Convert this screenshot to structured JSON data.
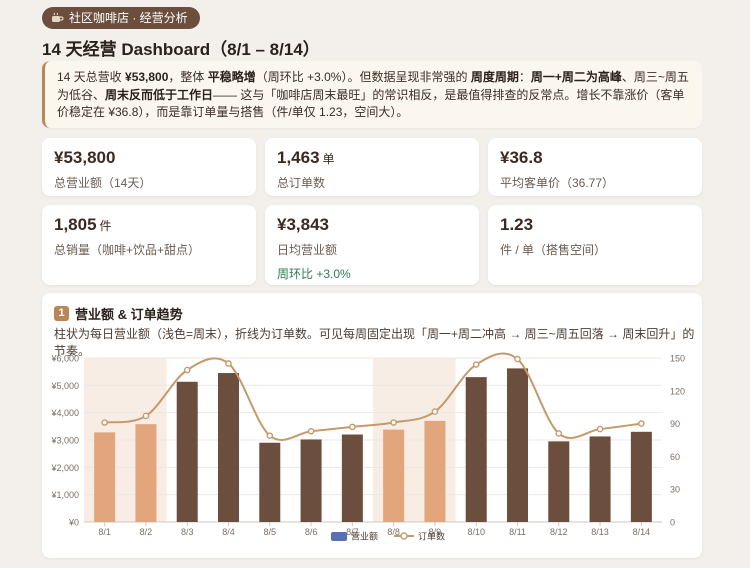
{
  "header": {
    "tag": "社区咖啡店 · 经营分析",
    "title": "14 天经营 Dashboard（8/1 – 8/14）"
  },
  "summary": {
    "s1": "14 天总营收 ",
    "s2": "¥53,800",
    "s3": "，整体 ",
    "s4": "平稳略增",
    "s5": "（周环比 +3.0%）。但数据呈现非常强的 ",
    "s6": "周度周期",
    "s7": "：",
    "s8": "周一+周二为高峰",
    "s9": "、周三~周五为低谷、",
    "s10": "周末反而低于工作日",
    "s11": "—— 这与「咖啡店周末最旺」的常识相反，是最值得排查的反常点。增长不靠涨价（客单价稳定在 ¥36.8），而是靠订单量与搭售（件/单仅 1.23，空间大）。"
  },
  "kpis": [
    {
      "value": "¥53,800",
      "unit": "",
      "label": "总营业额（14天）",
      "delta": ""
    },
    {
      "value": "1,463",
      "unit": "单",
      "label": "总订单数",
      "delta": ""
    },
    {
      "value": "¥36.8",
      "unit": "",
      "label": "平均客单价（36.77）",
      "delta": ""
    },
    {
      "value": "1,805",
      "unit": "件",
      "label": "总销量（咖啡+饮品+甜点）",
      "delta": ""
    },
    {
      "value": "¥3,843",
      "unit": "",
      "label": "日均营业额",
      "delta": "周环比 +3.0%"
    },
    {
      "value": "1.23",
      "unit": "",
      "label": "件 / 单（搭售空间）",
      "delta": ""
    }
  ],
  "chart_section": {
    "badge": "1",
    "title": "营业额 & 订单趋势",
    "desc": "柱状为每日营业额（浅色=周末），折线为订单数。可见每周固定出现「周一+周二冲高 → 周三~周五回落 → 周末回升」的节奏。"
  },
  "colors": {
    "weekday_bar": "#6b4e3d",
    "weekend_bar": "#e3a57c",
    "weekend_band": "#f8ede4",
    "line": "#c49a6c",
    "accent": "#b98757"
  },
  "chart_data": {
    "type": "bar",
    "categories": [
      "8/1",
      "8/2",
      "8/3",
      "8/4",
      "8/5",
      "8/6",
      "8/7",
      "8/8",
      "8/9",
      "8/10",
      "8/11",
      "8/12",
      "8/13",
      "8/14"
    ],
    "weekend": [
      true,
      true,
      false,
      false,
      false,
      false,
      false,
      true,
      true,
      false,
      false,
      false,
      false,
      false
    ],
    "series": [
      {
        "name": "营业额",
        "type": "bar",
        "axis": "left",
        "values": [
          3280,
          3580,
          5130,
          5450,
          2900,
          3020,
          3200,
          3380,
          3700,
          5300,
          5620,
          2950,
          3130,
          3300
        ]
      },
      {
        "name": "订单数",
        "type": "line",
        "axis": "right",
        "values": [
          91,
          97,
          139,
          145,
          79,
          83,
          87,
          91,
          101,
          144,
          149,
          81,
          85,
          90
        ]
      }
    ],
    "y_left": {
      "min": 0,
      "max": 6000,
      "ticks": [
        "¥0",
        "¥1,000",
        "¥2,000",
        "¥3,000",
        "¥4,000",
        "¥5,000",
        "¥6,000"
      ]
    },
    "y_right": {
      "min": 0,
      "max": 150,
      "ticks": [
        "0",
        "30",
        "60",
        "90",
        "120",
        "150"
      ]
    },
    "legend": [
      "营业额",
      "订单数"
    ],
    "legend_position": "bottom",
    "grid": true
  }
}
